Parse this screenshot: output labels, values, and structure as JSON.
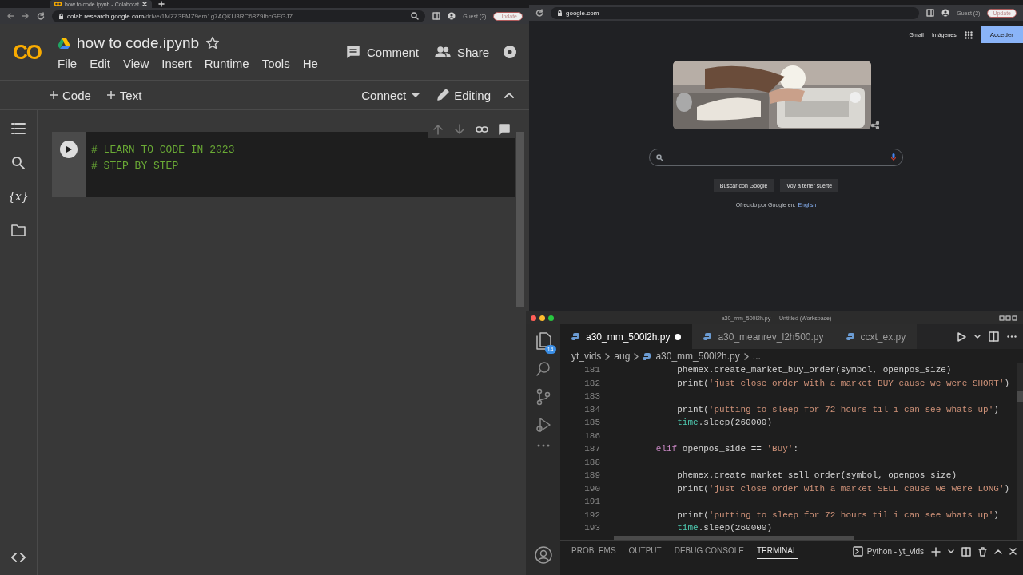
{
  "colab_browser": {
    "tab_title": "how to code.ipynb - Colaborat",
    "url_host": "colab.research.google.com",
    "url_path": "/drive/1MZZ3FMZ9em1g7AQKU3RC68Z9lbcGEGJ7",
    "profile": "Guest (2)",
    "update": "Update"
  },
  "colab": {
    "logo": "CO",
    "notebook_title": "how to code.ipynb",
    "menu": [
      "File",
      "Edit",
      "View",
      "Insert",
      "Runtime",
      "Tools",
      "He"
    ],
    "comment": "Comment",
    "share": "Share",
    "toolbar": {
      "add_code": "Code",
      "add_text": "Text",
      "connect": "Connect",
      "editing": "Editing"
    },
    "sidebar": [
      {
        "kind": "toc"
      },
      {
        "kind": "search"
      },
      {
        "kind": "variables",
        "label": "{x}"
      },
      {
        "kind": "files"
      }
    ],
    "cell": {
      "lines": [
        "# LEARN TO CODE IN 2023",
        "# STEP BY STEP"
      ]
    }
  },
  "google_browser": {
    "url": "google.com",
    "profile": "Guest (2)",
    "update": "Update"
  },
  "google": {
    "links": [
      "Gmail",
      "Imágenes"
    ],
    "sign_in": "Acceder",
    "buttons": [
      "Buscar con Google",
      "Voy a tener suerte"
    ],
    "offered": "Ofrecido por Google en:",
    "language": "English"
  },
  "vscode": {
    "title": "a30_mm_500l2h.py — Untitled (Workspace)",
    "badge": "14",
    "tabs": [
      {
        "label": "a30_mm_500l2h.py",
        "selected": true,
        "modified": true
      },
      {
        "label": "a30_meanrev_l2h500.py",
        "selected": false,
        "modified": false
      },
      {
        "label": "ccxt_ex.py",
        "selected": false,
        "modified": false
      }
    ],
    "breadcrumb": [
      "yt_vids",
      "aug",
      "a30_mm_500l2h.py",
      "..."
    ],
    "lines": [
      {
        "number": "181",
        "segments": [
          {
            "kind": "plain",
            "text": "            phemex.create_market_buy_order(symbol, openpos_size)"
          }
        ]
      },
      {
        "number": "182",
        "segments": [
          {
            "kind": "plain",
            "text": "            print("
          },
          {
            "kind": "string",
            "text": "'just close order with a market BUY cause we were SHORT'"
          },
          {
            "kind": "plain",
            "text": ")"
          }
        ]
      },
      {
        "number": "183"
      },
      {
        "number": "184",
        "segments": [
          {
            "kind": "plain",
            "text": "            print("
          },
          {
            "kind": "string",
            "text": "'putting to sleep for 72 hours til i can see whats up'"
          },
          {
            "kind": "plain",
            "text": ")"
          }
        ]
      },
      {
        "number": "185",
        "segments": [
          {
            "kind": "module",
            "text": "            time"
          },
          {
            "kind": "plain",
            "text": ".sleep(260000)"
          }
        ]
      },
      {
        "number": "186"
      },
      {
        "number": "187",
        "segments": [
          {
            "kind": "keyword",
            "text": "        elif"
          },
          {
            "kind": "plain",
            "text": " openpos_side == "
          },
          {
            "kind": "string",
            "text": "'Buy'"
          },
          {
            "kind": "plain",
            "text": ":"
          }
        ]
      },
      {
        "number": "188"
      },
      {
        "number": "189",
        "segments": [
          {
            "kind": "plain",
            "text": "            phemex.create_market_sell_order(symbol, openpos_size)"
          }
        ]
      },
      {
        "number": "190",
        "segments": [
          {
            "kind": "plain",
            "text": "            print("
          },
          {
            "kind": "string",
            "text": "'just close order with a market SELL cause we were LONG'"
          },
          {
            "kind": "plain",
            "text": ")"
          }
        ]
      },
      {
        "number": "191"
      },
      {
        "number": "192",
        "segments": [
          {
            "kind": "plain",
            "text": "            print("
          },
          {
            "kind": "string",
            "text": "'putting to sleep for 72 hours til i can see whats up'"
          },
          {
            "kind": "plain",
            "text": ")"
          }
        ]
      },
      {
        "number": "193",
        "segments": [
          {
            "kind": "module",
            "text": "            time"
          },
          {
            "kind": "plain",
            "text": ".sleep(260000)"
          }
        ]
      }
    ],
    "panel_tabs": [
      {
        "label": "PROBLEMS",
        "selected": false
      },
      {
        "label": "OUTPUT",
        "selected": false
      },
      {
        "label": "DEBUG CONSOLE",
        "selected": false
      },
      {
        "label": "TERMINAL",
        "selected": true
      }
    ],
    "terminal_name": "Python - yt_vids"
  }
}
